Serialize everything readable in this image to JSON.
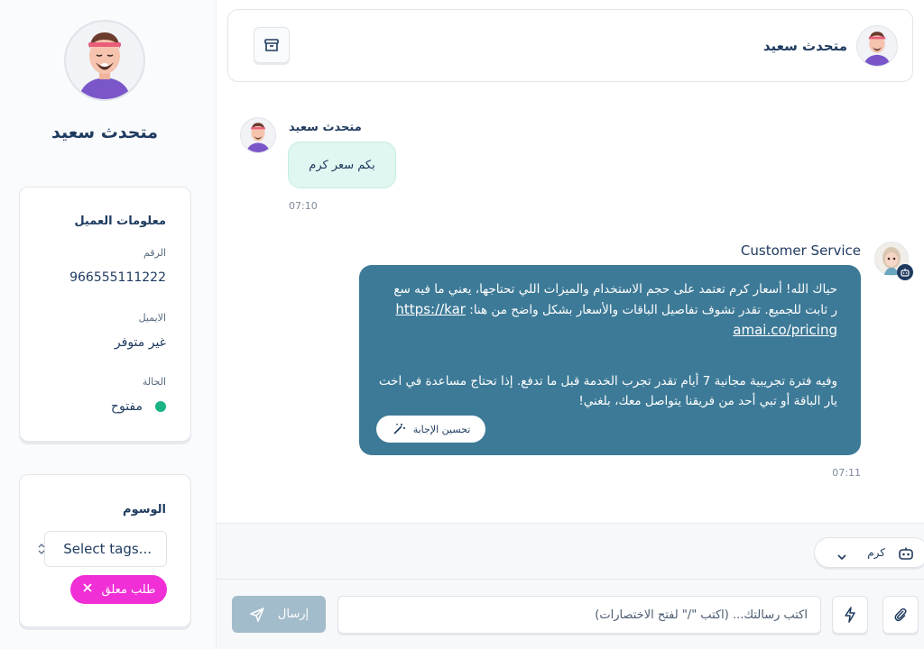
{
  "contact": {
    "name": "متحدث سعيد"
  },
  "customer_info": {
    "title": "معلومات العميل",
    "number_label": "الرقم",
    "number_value": "966555111222",
    "email_label": "الايميل",
    "email_value": "غير متوفر",
    "status_label": "الحالة",
    "status_value": "مفتوح",
    "status_color": "#1ab385"
  },
  "tags": {
    "title": "الوسوم",
    "select_value": "Select tags...",
    "chip_label": "طلب معلق",
    "chip_color": "#f12fd6"
  },
  "header": {
    "name": "متحدث سعيد",
    "archive_icon": "archive-icon"
  },
  "messages": {
    "incoming": {
      "sender": "متحدث سعيد",
      "text": "بكم سعر كرم",
      "time": "07:10"
    },
    "outgoing": {
      "sender": "Customer Service",
      "line1": "حياك الله! أسعار كرم تعتمد على حجم الاستخدام والميزات اللي تحتاجها، يعني ما فيه سع",
      "line2": "ر ثابت للجميع. تقدر تشوف تفاصيل الباقات والأسعار بشكل واضح من هنا:",
      "link_part1": "https://kar",
      "link_part2": "amai.co/pricing",
      "line3": "وفيه فترة تجريبية مجانية 7 أيام تقدر تجرب الخدمة قبل ما تدفع. إذا تحتاج مساعدة في اخت",
      "line4": "يار الباقة أو تبي أحد من فريقنا يتواصل معك، بلغني!",
      "improve_label": "تحسين الإجابة",
      "time": "07:11",
      "bubble_color": "#3d7a97"
    }
  },
  "agent": {
    "label": "كرم",
    "icon": "bot-icon"
  },
  "composer": {
    "placeholder": "اكتب رسالتك... (اكتب \"/\" لفتح الاختصارات)",
    "send_label": "إرسال"
  }
}
